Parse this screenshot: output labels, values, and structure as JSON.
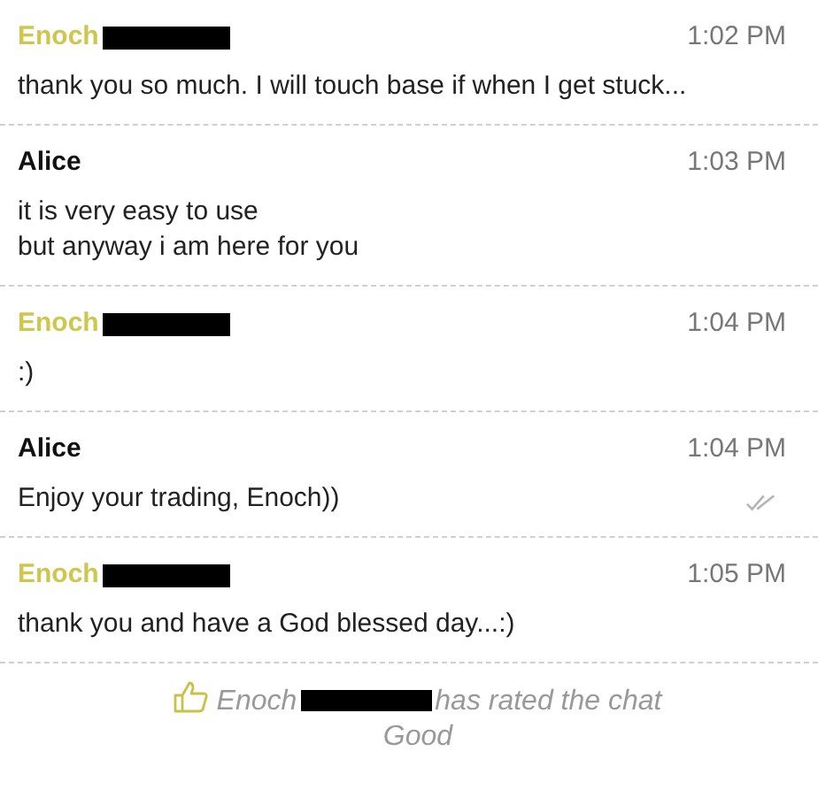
{
  "messages": [
    {
      "sender": "Enoch",
      "kind": "visitor",
      "redacted": true,
      "time": "1:02 PM",
      "lines": [
        "thank you so much. I will touch base if when I get stuck..."
      ],
      "read": false
    },
    {
      "sender": "Alice",
      "kind": "agent",
      "redacted": false,
      "time": "1:03 PM",
      "lines": [
        "it is very easy to use",
        "but anyway i am here for you"
      ],
      "read": false
    },
    {
      "sender": "Enoch",
      "kind": "visitor",
      "redacted": true,
      "time": "1:04 PM",
      "lines": [
        ":)"
      ],
      "read": false
    },
    {
      "sender": "Alice",
      "kind": "agent",
      "redacted": false,
      "time": "1:04 PM",
      "lines": [
        "Enjoy your trading, Enoch))"
      ],
      "read": true
    },
    {
      "sender": "Enoch",
      "kind": "visitor",
      "redacted": true,
      "time": "1:05 PM",
      "lines": [
        "thank you and have a God blessed day...:)"
      ],
      "read": false
    }
  ],
  "rating": {
    "name": "Enoch",
    "redacted": true,
    "text": "has rated the chat Good"
  }
}
